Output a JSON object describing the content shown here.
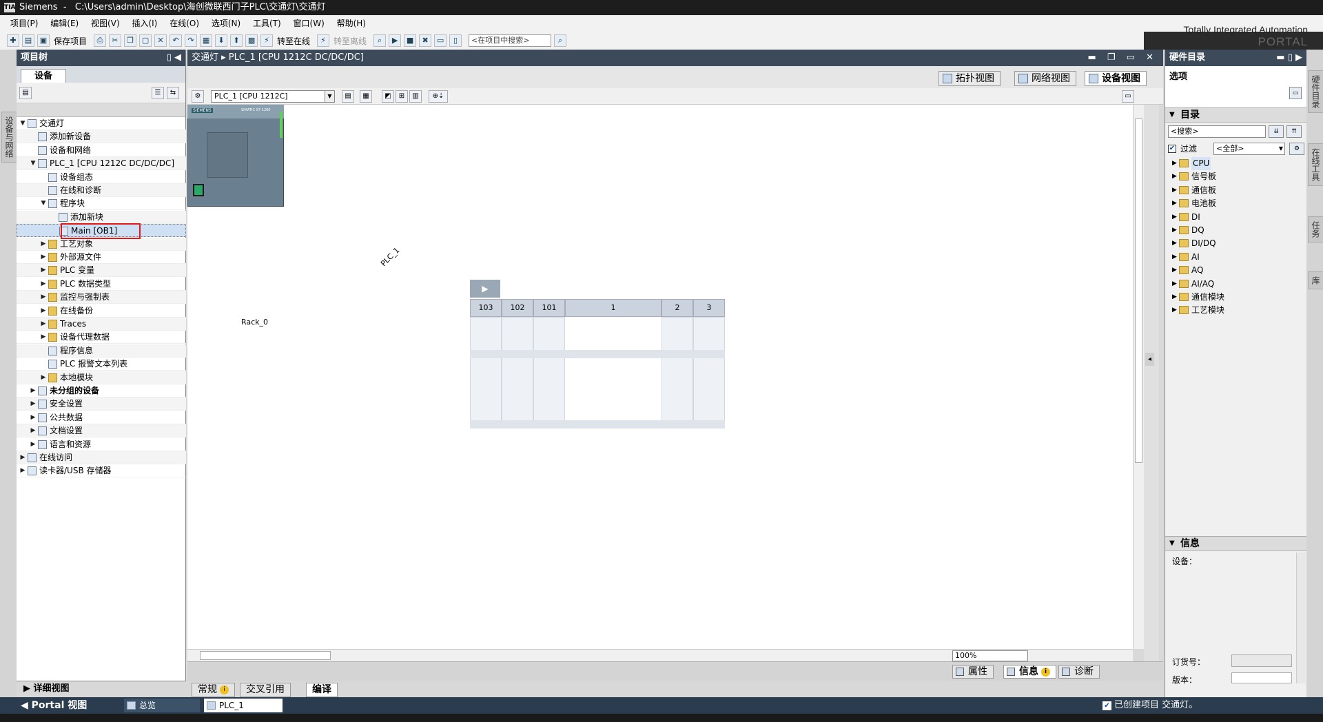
{
  "titlebar": {
    "logo": "TIA",
    "app": "Siemens",
    "path": "C:\\Users\\admin\\Desktop\\海创微联西门子PLC\\交通灯\\交通灯"
  },
  "menu": [
    "项目(P)",
    "编辑(E)",
    "视图(V)",
    "插入(I)",
    "在线(O)",
    "选项(N)",
    "工具(T)",
    "窗口(W)",
    "帮助(H)"
  ],
  "branding": {
    "line1": "Totally Integrated Automation",
    "line2": "PORTAL"
  },
  "toolbar": {
    "save_label": "保存项目",
    "go_online": "转至在线",
    "go_offline": "转至离线",
    "search_placeholder": "<在项目中搜索>"
  },
  "left_strip": {
    "tab": "设备与网络"
  },
  "project_tree": {
    "title": "项目树",
    "tab": "设备",
    "rows": [
      {
        "label": "交通灯",
        "level": 0,
        "arrow": "▼"
      },
      {
        "label": "添加新设备",
        "level": 1,
        "arrow": ""
      },
      {
        "label": "设备和网络",
        "level": 1,
        "arrow": ""
      },
      {
        "label": "PLC_1 [CPU 1212C DC/DC/DC]",
        "level": 1,
        "arrow": "▼"
      },
      {
        "label": "设备组态",
        "level": 2,
        "arrow": ""
      },
      {
        "label": "在线和诊断",
        "level": 2,
        "arrow": ""
      },
      {
        "label": "程序块",
        "level": 2,
        "arrow": "▼"
      },
      {
        "label": "添加新块",
        "level": 3,
        "arrow": ""
      },
      {
        "label": "Main [OB1]",
        "level": 3,
        "arrow": "",
        "selected": true
      },
      {
        "label": "工艺对象",
        "level": 2,
        "arrow": "▶"
      },
      {
        "label": "外部源文件",
        "level": 2,
        "arrow": "▶"
      },
      {
        "label": "PLC 变量",
        "level": 2,
        "arrow": "▶"
      },
      {
        "label": "PLC 数据类型",
        "level": 2,
        "arrow": "▶"
      },
      {
        "label": "监控与强制表",
        "level": 2,
        "arrow": "▶"
      },
      {
        "label": "在线备份",
        "level": 2,
        "arrow": "▶"
      },
      {
        "label": "Traces",
        "level": 2,
        "arrow": "▶"
      },
      {
        "label": "设备代理数据",
        "level": 2,
        "arrow": "▶"
      },
      {
        "label": "程序信息",
        "level": 2,
        "arrow": ""
      },
      {
        "label": "PLC 报警文本列表",
        "level": 2,
        "arrow": ""
      },
      {
        "label": "本地模块",
        "level": 2,
        "arrow": "▶"
      },
      {
        "label": "未分组的设备",
        "level": 1,
        "arrow": "▶",
        "bold": true
      },
      {
        "label": "安全设置",
        "level": 1,
        "arrow": "▶"
      },
      {
        "label": "公共数据",
        "level": 1,
        "arrow": "▶"
      },
      {
        "label": "文档设置",
        "level": 1,
        "arrow": "▶"
      },
      {
        "label": "语言和资源",
        "level": 1,
        "arrow": "▶"
      },
      {
        "label": "在线访问",
        "level": 0,
        "arrow": "▶"
      },
      {
        "label": "读卡器/USB 存储器",
        "level": 0,
        "arrow": "▶"
      }
    ],
    "detail_view": "详细视图"
  },
  "editor": {
    "breadcrumb": "交通灯 ▸ PLC_1 [CPU 1212C DC/DC/DC]",
    "view_tabs": [
      "拓扑视图",
      "网络视图",
      "设备视图"
    ],
    "device_select": "PLC_1 [CPU 1212C]",
    "plc_label": "PLC_1",
    "rack_name": "Rack_0",
    "slots": [
      "103",
      "102",
      "101",
      "1",
      "2",
      "3"
    ],
    "cpu_brand": "SIEMENS",
    "cpu_model": "SIMATIC S7-1200",
    "zoom": "100%"
  },
  "inspector": {
    "tabs": [
      "属性",
      "信息",
      "诊断"
    ],
    "subtabs": [
      "常规",
      "交叉引用",
      "编译"
    ]
  },
  "catalog": {
    "title": "硬件目录",
    "options": "选项",
    "section_catalog": "目录",
    "search_placeholder": "<搜索>",
    "filter_label": "过滤",
    "filter_value": "<全部>",
    "items": [
      "CPU",
      "信号板",
      "通信板",
      "电池板",
      "DI",
      "DQ",
      "DI/DQ",
      "AI",
      "AQ",
      "AI/AQ",
      "通信模块",
      "工艺模块"
    ],
    "section_info": "信息",
    "info_device": "设备：",
    "info_order": "订货号：",
    "info_version": "版本："
  },
  "right_strip": [
    "硬件目录",
    "在线工具",
    "任务",
    "库"
  ],
  "statusbar": {
    "portal": "Portal 视图",
    "tab_overview": "总览",
    "tab_plc": "PLC_1",
    "message": "已创建项目 交通灯。"
  }
}
